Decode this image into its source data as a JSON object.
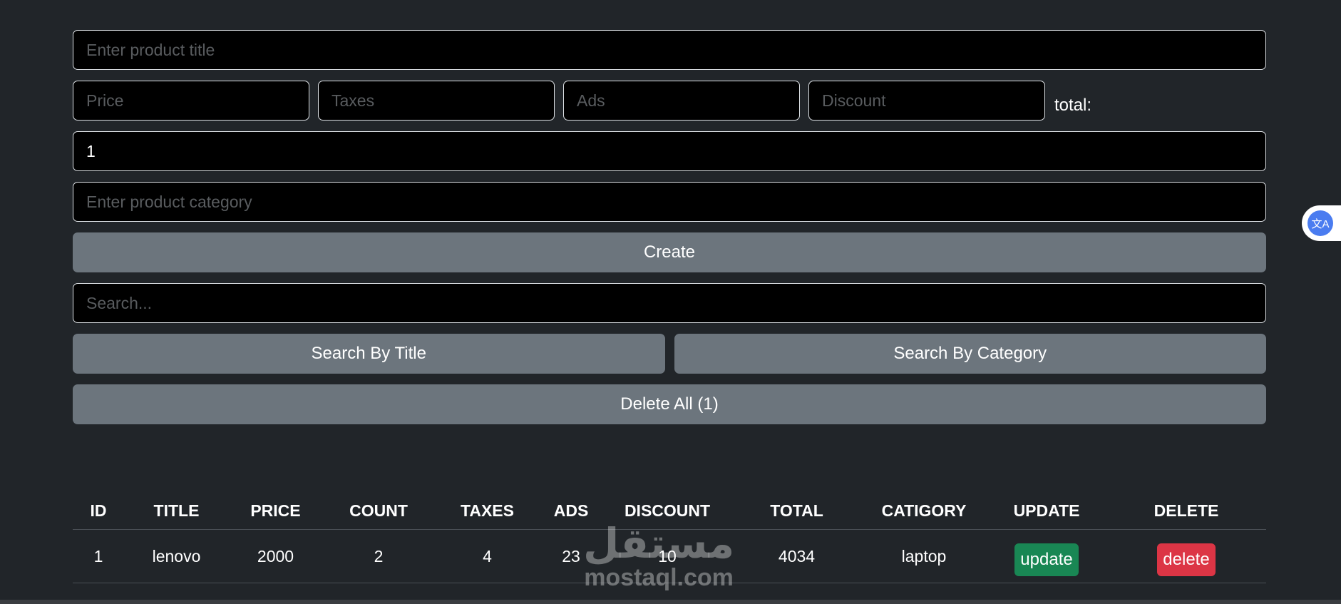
{
  "form": {
    "title_placeholder": "Enter product title",
    "price_placeholder": "Price",
    "taxes_placeholder": "Taxes",
    "ads_placeholder": "Ads",
    "discount_placeholder": "Discount",
    "total_label": "total:",
    "count_value": "1",
    "category_placeholder": "Enter product category",
    "create_label": "Create"
  },
  "search": {
    "placeholder": "Search...",
    "by_title_label": "Search By Title",
    "by_category_label": "Search By Category",
    "delete_all_label": "Delete All (1)"
  },
  "table": {
    "headers": [
      "ID",
      "TITLE",
      "PRICE",
      "COUNT",
      "TAXES",
      "ADS",
      "DISCOUNT",
      "TOTAL",
      "CATIGORY",
      "UPDATE",
      "DELETE"
    ],
    "rows": [
      {
        "id": "1",
        "title": "lenovo",
        "price": "2000",
        "count": "2",
        "taxes": "4",
        "ads": "23",
        "discount": "10",
        "total": "4034",
        "category": "laptop",
        "update_label": "update",
        "delete_label": "delete"
      }
    ]
  },
  "translate_widget": {
    "icon": "translate-icon",
    "glyph": "文A"
  },
  "watermark": {
    "arabic": "مستقل",
    "latin": "mostaql.com"
  },
  "colors": {
    "background": "#212529",
    "input_background": "#000000",
    "button_secondary": "#6c757d",
    "update_button": "#198754",
    "delete_button": "#dc3545"
  }
}
